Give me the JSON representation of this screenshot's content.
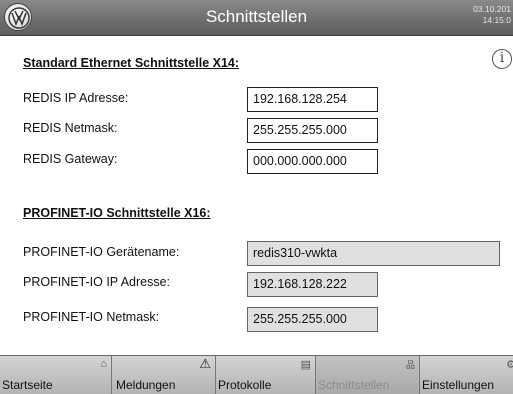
{
  "header": {
    "title": "Schnittstellen",
    "date": "03.10.201",
    "time": "14:15:0",
    "logo_icon": "vw-logo-icon"
  },
  "ethernet": {
    "section_title": "Standard Ethernet Schnittstelle X14:",
    "ip_label": "REDIS IP Adresse:",
    "ip_value": "192.168.128.254",
    "netmask_label": "REDIS Netmask:",
    "netmask_value": "255.255.255.000",
    "gateway_label": "REDIS Gateway:",
    "gateway_value": "000.000.000.000"
  },
  "profinet": {
    "section_title": "PROFINET-IO Schnittstelle X16:",
    "name_label": "PROFINET-IO Gerätename:",
    "name_value": "redis310-vwkta",
    "ip_label": "PROFINET-IO IP Adresse:",
    "ip_value": "192.168.128.222",
    "netmask_label": "PROFINET-IO Netmask:",
    "netmask_value": "255.255.255.000"
  },
  "info_icon": "i",
  "nav": {
    "tabs": [
      {
        "label": "Startseite",
        "icon": "home-icon",
        "glyph": "⌂"
      },
      {
        "label": "Meldungen",
        "icon": "warning-icon",
        "glyph": "⚠"
      },
      {
        "label": "Protokolle",
        "icon": "log-icon",
        "glyph": "▤"
      },
      {
        "label": "Schnittstellen",
        "icon": "network-icon",
        "glyph": "品"
      },
      {
        "label": "Einstellungen",
        "icon": "settings-icon",
        "glyph": "⚙"
      }
    ]
  },
  "colors": {
    "header": "#6d6d6d",
    "active_tab_text": "#8b8b8b"
  }
}
